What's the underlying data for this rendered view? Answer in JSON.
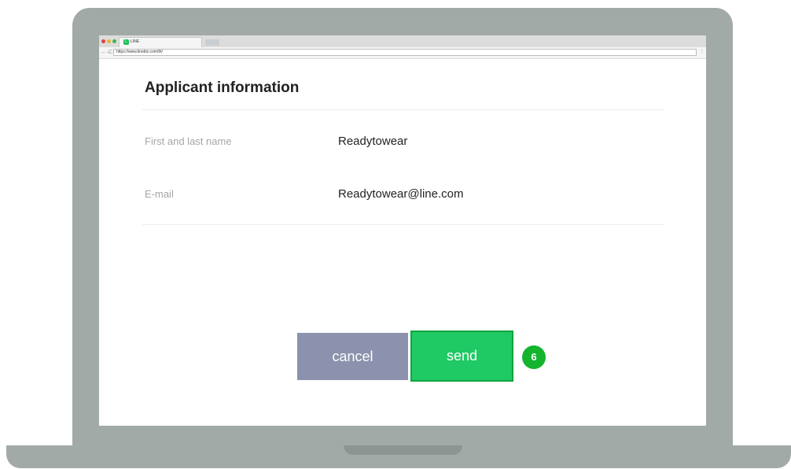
{
  "browser": {
    "tab_title": "LINE",
    "tab_icon_glyph": "L",
    "url": "https://www.linebiz.com/th/",
    "back_glyph": "←",
    "forward_glyph": "→",
    "reload_glyph": "C",
    "menu_glyph": "⋮",
    "traffic_lights": [
      "#e0443c",
      "#e9b43a",
      "#45b449"
    ]
  },
  "form": {
    "title": "Applicant information",
    "fields": [
      {
        "label": "First and last name",
        "value": "Readytowear"
      },
      {
        "label": "E-mail",
        "value": "Readytowear@line.com"
      }
    ],
    "cancel_label": "cancel",
    "send_label": "send",
    "step_badge": "6"
  },
  "colors": {
    "cancel": "#8c91ad",
    "send": "#1fc963",
    "badge": "#14b42e"
  }
}
